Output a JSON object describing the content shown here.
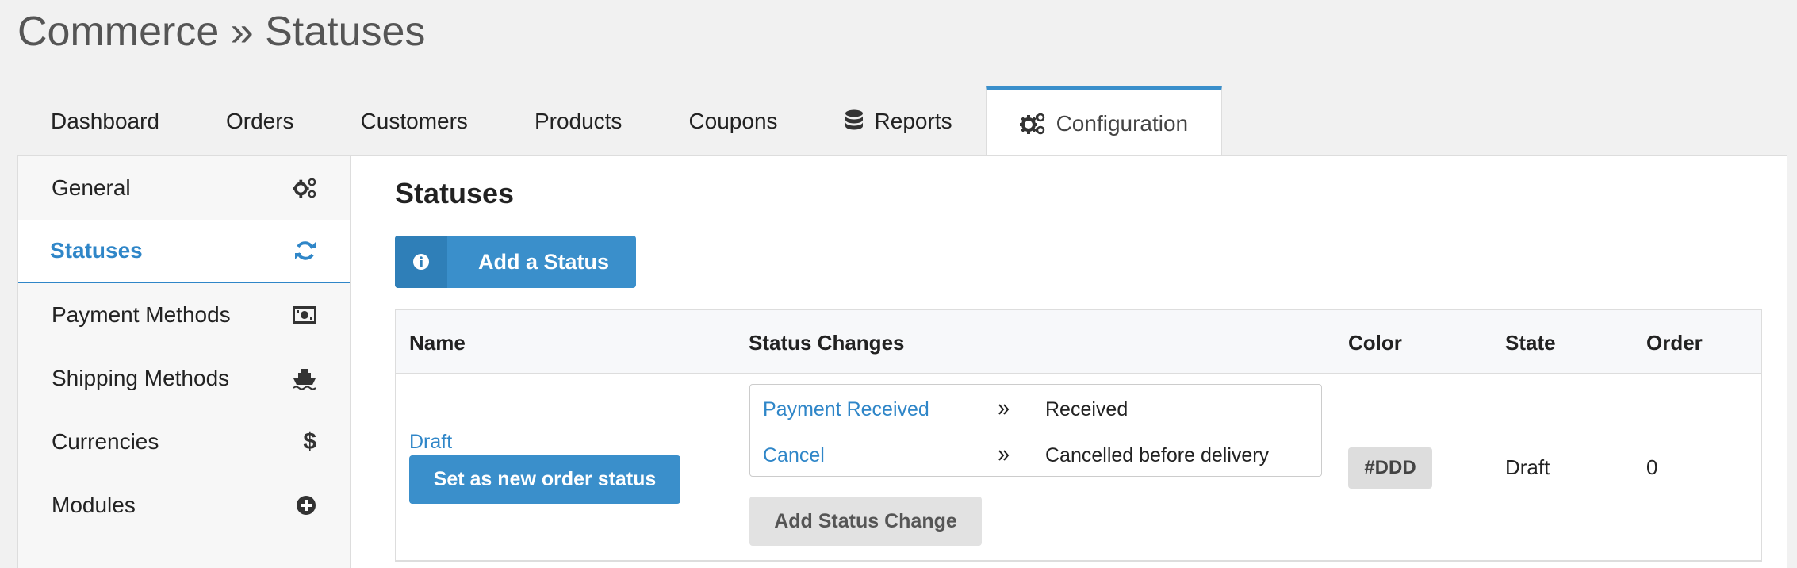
{
  "page": {
    "title": "Commerce » Statuses"
  },
  "tabs": [
    {
      "label": "Dashboard"
    },
    {
      "label": "Orders"
    },
    {
      "label": "Customers"
    },
    {
      "label": "Products"
    },
    {
      "label": "Coupons"
    },
    {
      "label": "Reports",
      "icon": "database-icon"
    },
    {
      "label": "Configuration",
      "icon": "cogs-icon",
      "active": true
    }
  ],
  "sidebar": {
    "items": [
      {
        "label": "General",
        "icon": "cogs-icon"
      },
      {
        "label": "Statuses",
        "icon": "refresh-icon",
        "active": true
      },
      {
        "label": "Payment Methods",
        "icon": "money-icon"
      },
      {
        "label": "Shipping Methods",
        "icon": "ship-icon"
      },
      {
        "label": "Currencies",
        "icon": "dollar-icon"
      },
      {
        "label": "Modules",
        "icon": "plus-circle-icon"
      }
    ]
  },
  "main": {
    "title": "Statuses",
    "add_button_label": "Add a Status",
    "add_button_icon": "info-icon",
    "table": {
      "headers": {
        "name": "Name",
        "status_changes": "Status Changes",
        "color": "Color",
        "state": "State",
        "order": "Order"
      },
      "rows": [
        {
          "name": "Draft",
          "set_button_label": "Set as new order status",
          "changes": [
            {
              "action": "Payment Received",
              "target": "Received"
            },
            {
              "action": "Cancel",
              "target": "Cancelled before delivery"
            }
          ],
          "add_change_label": "Add Status Change",
          "color": "#DDD",
          "state": "Draft",
          "order": "0"
        }
      ]
    }
  },
  "colors": {
    "accent": "#3a8fcb",
    "link": "#2f86c8",
    "badge_bg": "#dddddd"
  }
}
